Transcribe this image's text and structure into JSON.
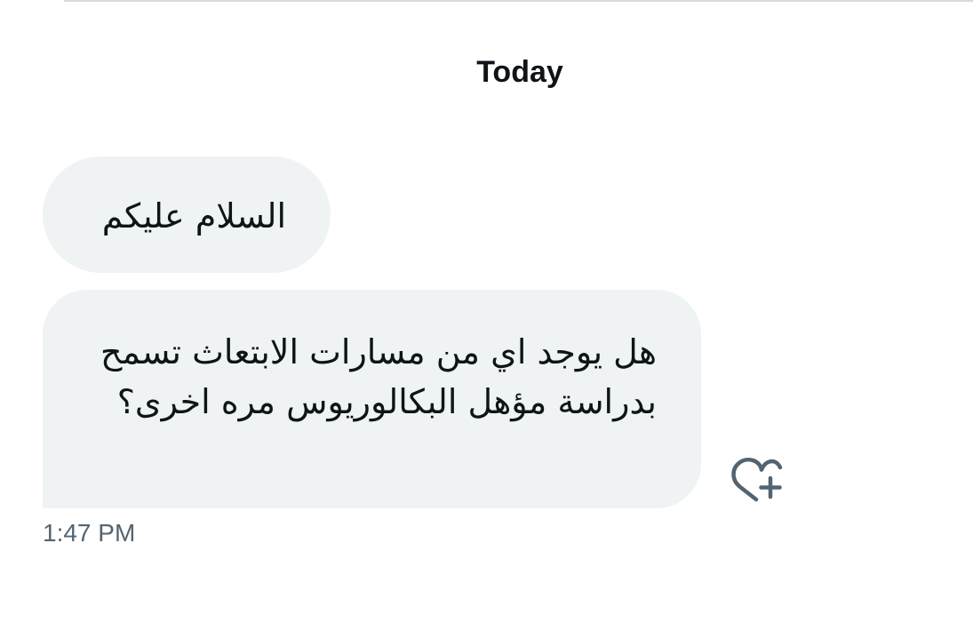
{
  "conversation": {
    "day_separator": "Today",
    "messages": [
      {
        "text": "السلام عليكم"
      },
      {
        "text": "هل يوجد اي من مسارات الابتعاث تسمح بدراسة مؤهل البكالوريوس مره اخرى؟"
      }
    ],
    "timestamp": "1:47 PM",
    "react_icon": "heart-plus-icon"
  },
  "colors": {
    "bubble_bg": "#eff3f4",
    "text": "#0f1419",
    "secondary_text": "#536471",
    "icon": "#536471"
  }
}
